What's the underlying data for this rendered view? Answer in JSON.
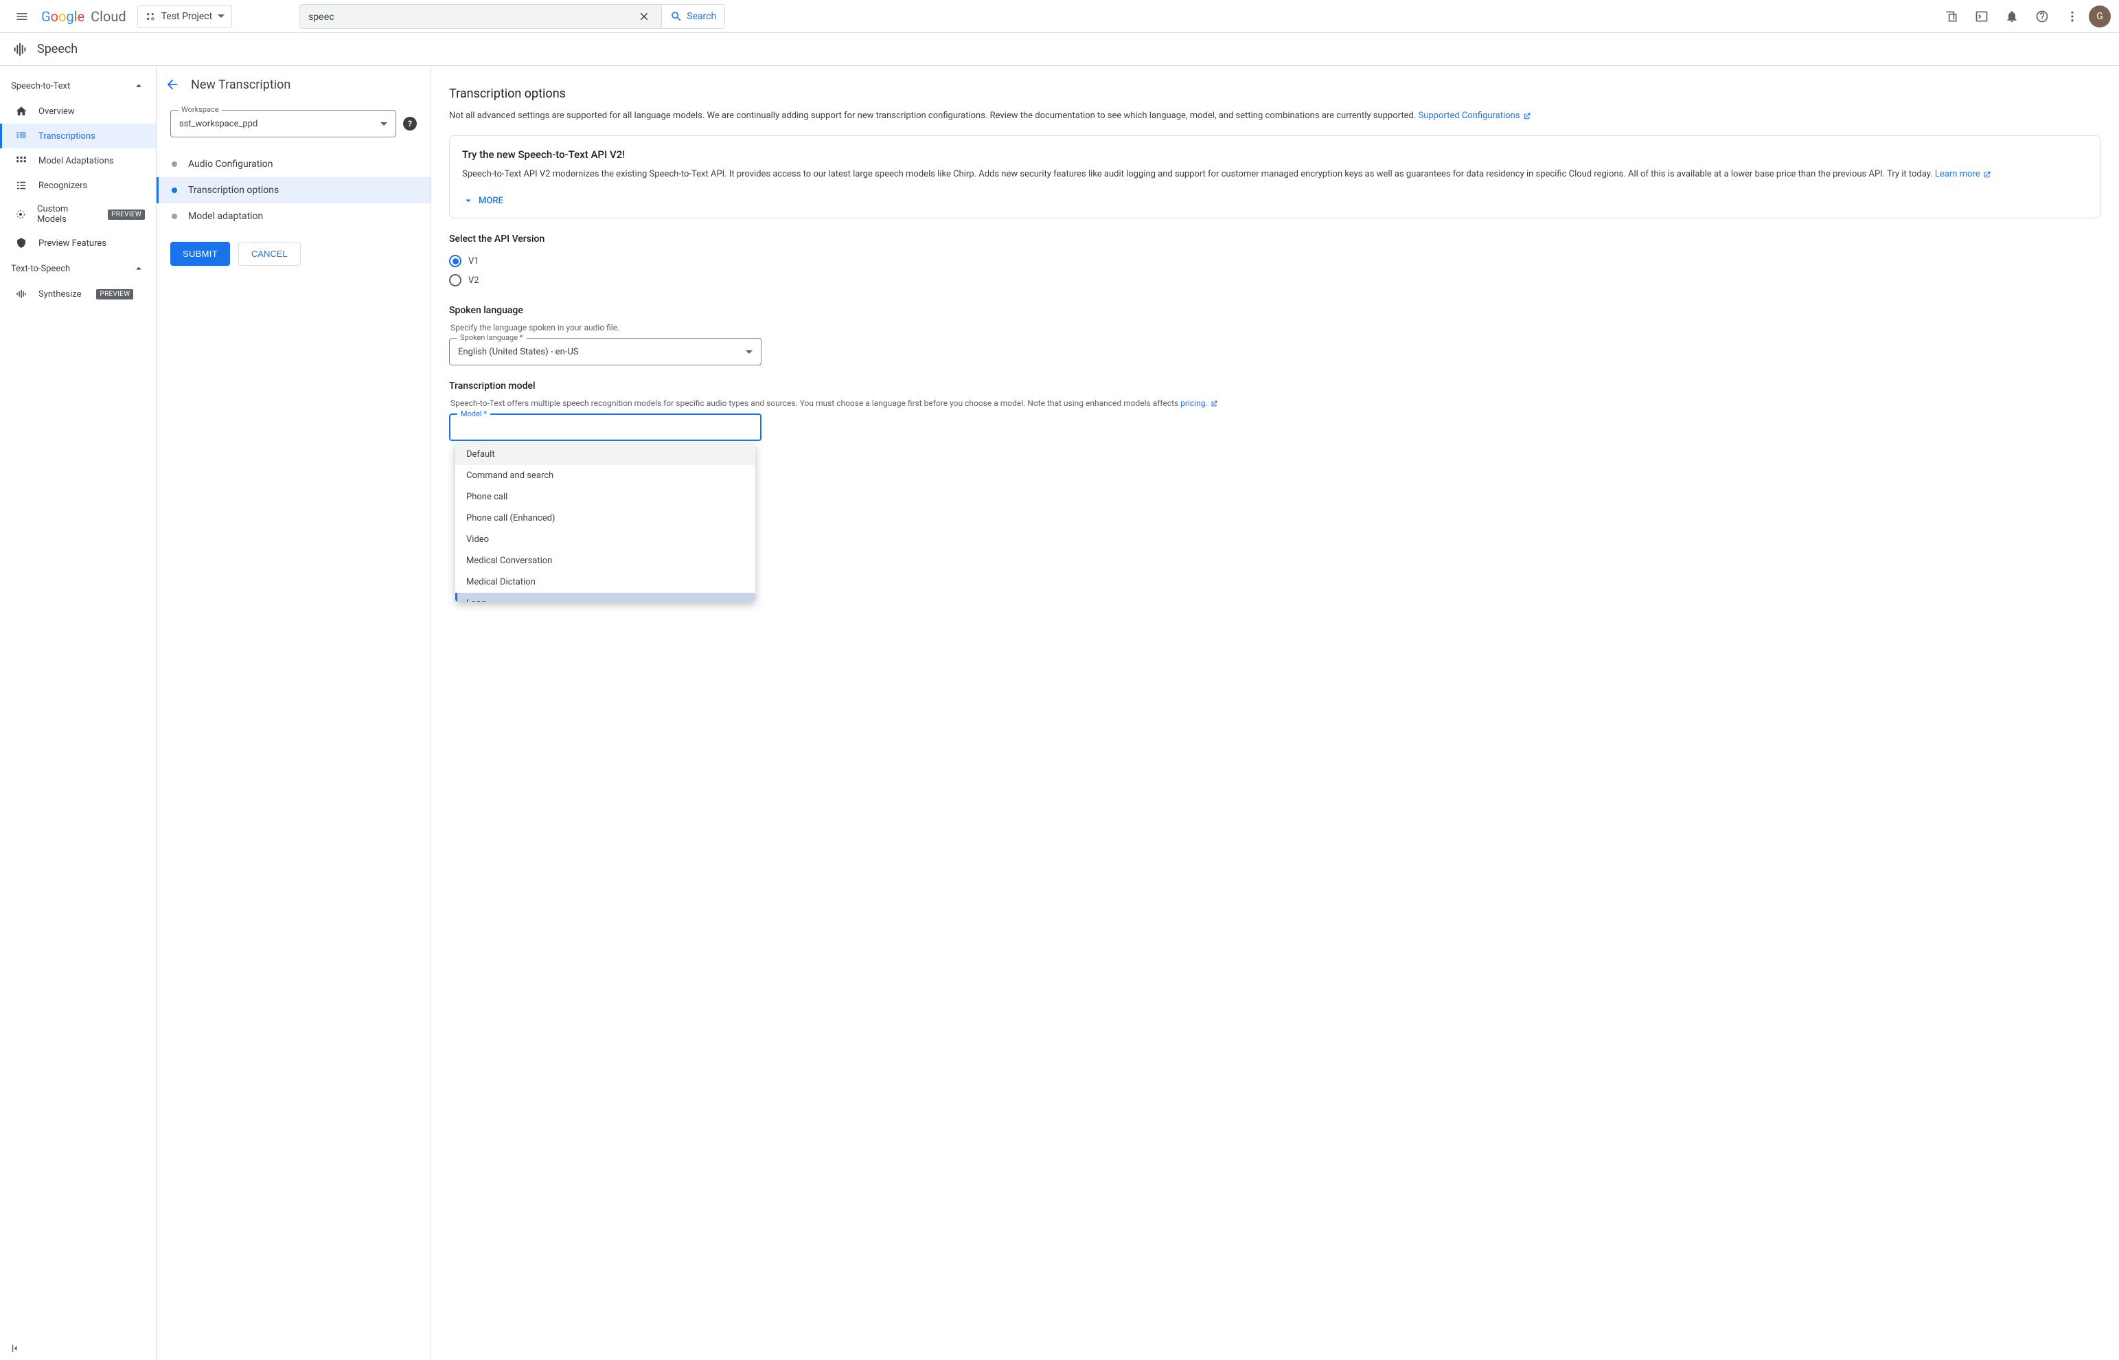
{
  "topbar": {
    "project": "Test Project",
    "search_value": "speec",
    "search_btn": "Search",
    "avatar_letter": "G"
  },
  "service": {
    "title": "Speech"
  },
  "sidebar": {
    "group1": "Speech-to-Text",
    "items1": [
      {
        "label": "Overview"
      },
      {
        "label": "Transcriptions"
      },
      {
        "label": "Model Adaptations"
      },
      {
        "label": "Recognizers"
      },
      {
        "label": "Custom Models",
        "badge": "PREVIEW"
      },
      {
        "label": "Preview Features"
      }
    ],
    "group2": "Text-to-Speech",
    "items2": [
      {
        "label": "Synthesize",
        "badge": "PREVIEW"
      }
    ]
  },
  "page": {
    "title": "New Transcription",
    "workspace_label": "Workspace",
    "workspace_value": "sst_workspace_ppd",
    "steps": [
      "Audio Configuration",
      "Transcription options",
      "Model adaptation"
    ],
    "submit": "SUBMIT",
    "cancel": "CANCEL"
  },
  "content": {
    "title": "Transcription options",
    "desc_a": "Not all advanced settings are supported for all language models. We are continually adding support for new transcription configurations. Review the documentation to see which language, model, and setting combinations are currently supported. ",
    "desc_link": "Supported Configurations",
    "card_title": "Try the new Speech-to-Text API V2!",
    "card_body": "Speech-to-Text API V2 modernizes the existing Speech-to-Text API. It provides access to our latest large speech models like Chirp. Adds new security features like audit logging and support for customer managed encryption keys as well as guarantees for data residency in specific Cloud regions. All of this is available at a lower base price than the previous API. Try it today. ",
    "card_link": "Learn more",
    "more": "MORE",
    "api_title": "Select the API Version",
    "api_v1": "V1",
    "api_v2": "V2",
    "lang_title": "Spoken language",
    "lang_hint": "Specify the language spoken in your audio file.",
    "lang_field_label": "Spoken language *",
    "lang_value": "English (United States) - en-US",
    "model_title": "Transcription model",
    "model_hint_a": "Speech-to-Text offers multiple speech recognition models for specific audio types and sources. You must choose a language first before you choose a model. Note that using enhanced models affects ",
    "model_hint_link": "pricing.",
    "model_field_label": "Model *",
    "model_options": [
      "Default",
      "Command and search",
      "Phone call",
      "Phone call (Enhanced)",
      "Video",
      "Medical Conversation",
      "Medical Dictation",
      "Long"
    ]
  }
}
